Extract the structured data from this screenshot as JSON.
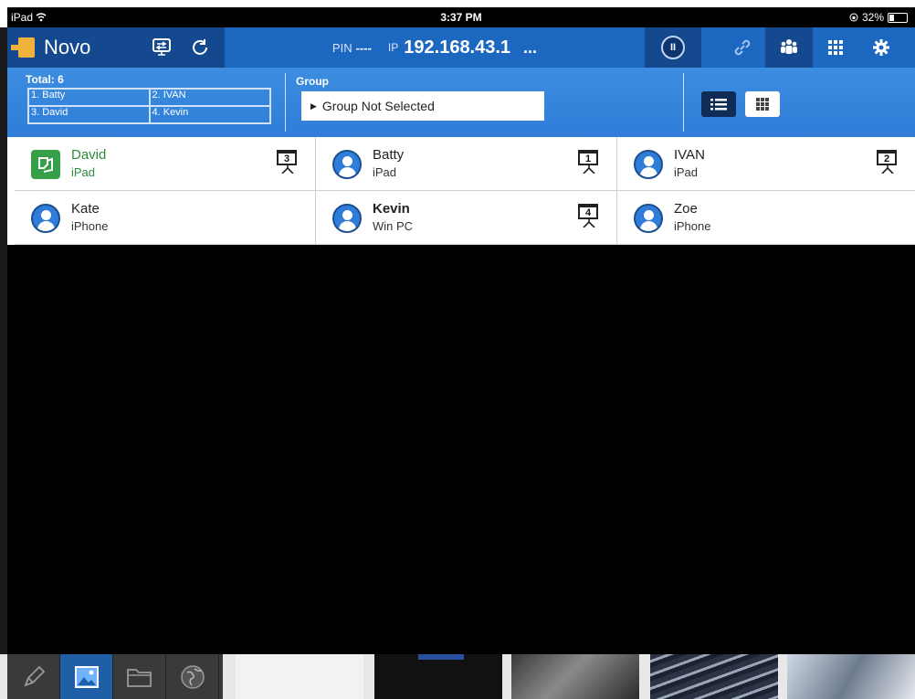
{
  "status_bar": {
    "carrier": "iPad",
    "time": "3:37 PM",
    "battery": "32%",
    "battery_level": 0.32
  },
  "toolbar": {
    "brand": "Novo",
    "pin_label": "PIN",
    "pin_value": "----",
    "ip_label": "IP",
    "ip_value": "192.168.43.1",
    "more": "...",
    "pause_label": "II"
  },
  "summary": {
    "total_label": "Total: 6",
    "queue": [
      "1. Batty",
      "2. IVAN",
      "3. David",
      "4. Kevin"
    ]
  },
  "group": {
    "title": "Group",
    "selected": "Group Not Selected"
  },
  "devices": [
    {
      "name": "David",
      "device": "iPad",
      "screen": "3",
      "self": true
    },
    {
      "name": "Batty",
      "device": "iPad",
      "screen": "1"
    },
    {
      "name": "IVAN",
      "device": "iPad",
      "screen": "2"
    },
    {
      "name": "Kate",
      "device": "iPhone",
      "screen": ""
    },
    {
      "name": "Kevin",
      "device": "Win PC",
      "screen": "4"
    },
    {
      "name": "Zoe",
      "device": "iPhone",
      "screen": ""
    }
  ],
  "colors": {
    "toolbar_blue": "#1c67c0",
    "toolbar_dark": "#14488f",
    "info_blue": "#2f7dd8",
    "self_green": "#36a049"
  },
  "icons": [
    "wifi-icon",
    "novo-logo-icon",
    "screen-share-icon",
    "refresh-icon",
    "pause-icon",
    "link-icon",
    "users-icon",
    "grid-icon",
    "settings-icon",
    "list-view-icon",
    "grid-view-icon",
    "pen-icon",
    "image-icon",
    "folder-icon",
    "globe-icon"
  ]
}
